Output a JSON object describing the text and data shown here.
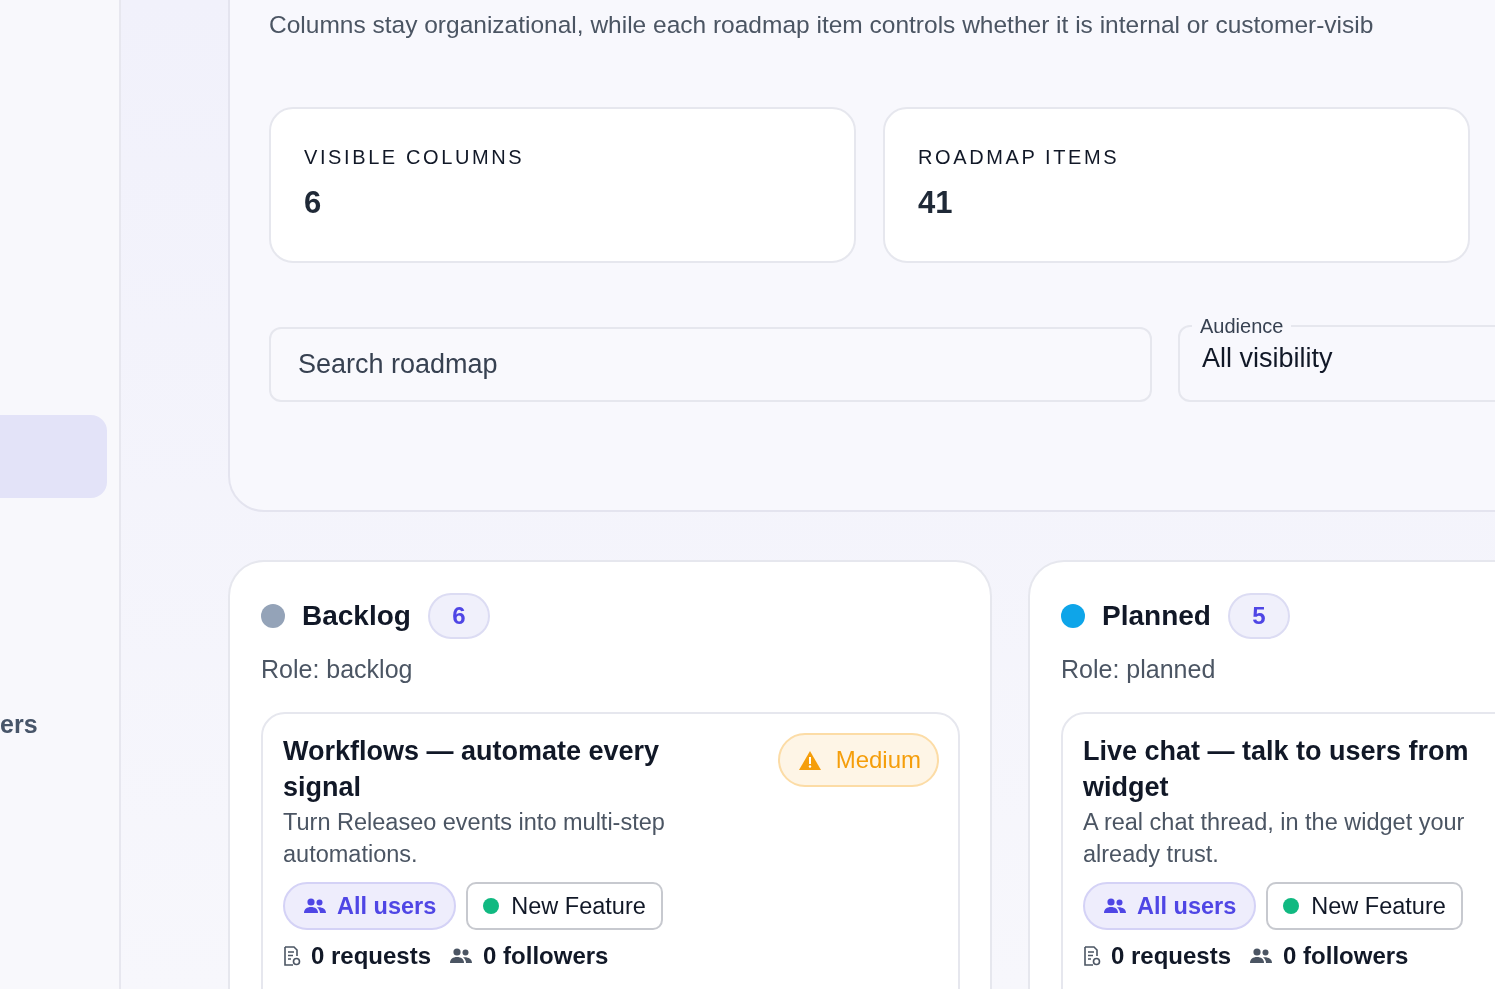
{
  "sidebar": {
    "items": [
      {
        "selected": true
      },
      {
        "label": "ers",
        "selected": false
      }
    ]
  },
  "panel": {
    "subtitle": "Columns stay organizational, while each roadmap item controls whether it is internal or customer-visib",
    "stats": [
      {
        "label": "VISIBLE COLUMNS",
        "value": "6"
      },
      {
        "label": "ROADMAP ITEMS",
        "value": "41"
      }
    ],
    "search": {
      "placeholder": "Search roadmap"
    },
    "audience": {
      "label": "Audience",
      "value": "All visibility"
    }
  },
  "columns": [
    {
      "name": "Backlog",
      "color": "#94a3b8",
      "count": "6",
      "role": "Role: backlog",
      "items": [
        {
          "title_lines": [
            "Workflows — automate every",
            "signal"
          ],
          "description_lines": [
            "Turn Releaseo events into multi-step",
            "automations."
          ],
          "priority": {
            "kind": "medium",
            "label": "Medium"
          },
          "tags": [
            {
              "kind": "audience",
              "label": "All users"
            },
            {
              "kind": "type",
              "label": "New Feature",
              "color": "#10b981"
            }
          ],
          "requests": "0 requests",
          "followers": "0 followers"
        }
      ]
    },
    {
      "name": "Planned",
      "color": "#0ea5e9",
      "count": "5",
      "role": "Role: planned",
      "items": [
        {
          "title_lines": [
            "Live chat — talk to users from",
            "widget"
          ],
          "description_lines": [
            "A real chat thread, in the widget your",
            "already trust."
          ],
          "tags": [
            {
              "kind": "audience",
              "label": "All users"
            },
            {
              "kind": "type",
              "label": "New Feature",
              "color": "#10b981"
            }
          ],
          "requests": "0 requests",
          "followers": "0 followers"
        }
      ]
    }
  ]
}
